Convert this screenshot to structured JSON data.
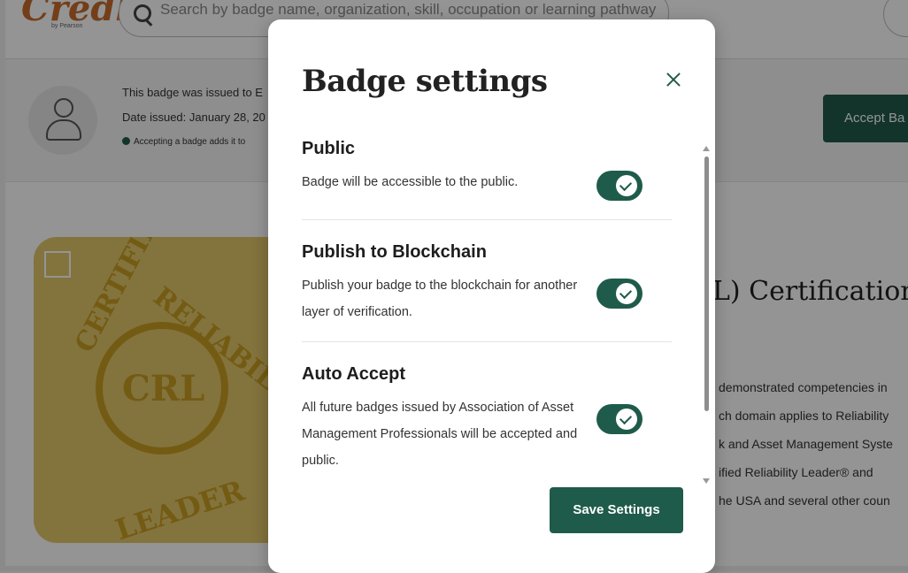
{
  "background": {
    "logo": "Credly",
    "logo_sub": "by Pearson",
    "search_placeholder": "Search by badge name, organization, skill, occupation or learning pathway",
    "banner_lines": [
      "This badge was issued to E",
      "Date issued: January 28, 20",
      "Accepting a badge adds it to"
    ],
    "accept_label": "Accept Ba",
    "badge_image_text": {
      "crl": "CRL",
      "certified": "CERTIFIED",
      "reliability": "RELIABILITY",
      "leader": "LEADER"
    },
    "cert_title": "L) Certification",
    "description_lines": [
      "demonstrated competencies in",
      "ch domain applies to Reliability",
      "k and Asset Management Syste",
      "ified Reliability Leader® and",
      "he USA and several other coun"
    ]
  },
  "modal": {
    "title": "Badge settings",
    "close_icon": "close-icon",
    "settings": [
      {
        "title": "Public",
        "description": "Badge will be accessible to the public.",
        "enabled": true
      },
      {
        "title": "Publish to Blockchain",
        "description": "Publish your badge to the blockchain for another layer of verification.",
        "enabled": true
      },
      {
        "title": "Auto Accept",
        "description": "All future badges issued by Association of Asset Management Professionals will be accepted and public.",
        "enabled": true
      }
    ],
    "save_label": "Save Settings"
  },
  "colors": {
    "accent": "#1f5b4a",
    "logo": "#c96b2c",
    "badge_gold": "#c89d21"
  }
}
